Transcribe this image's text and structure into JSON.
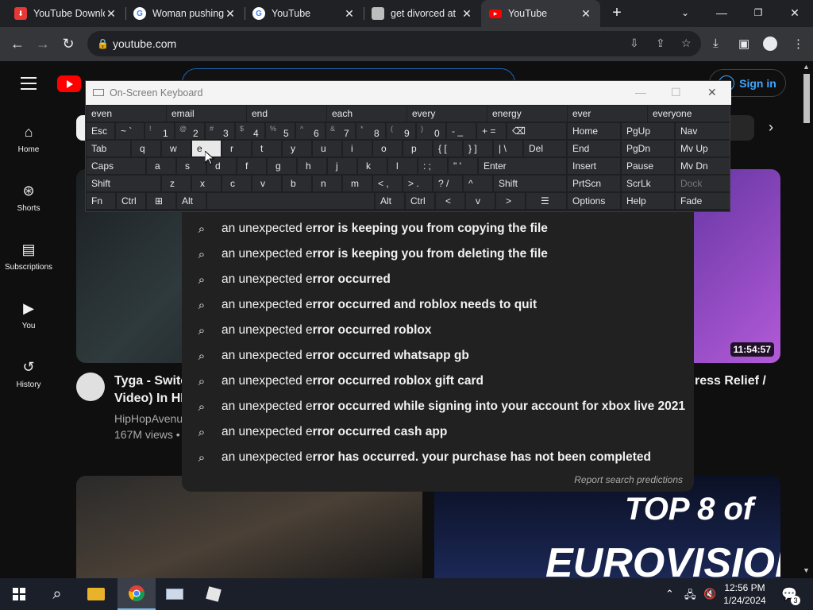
{
  "browser": {
    "tabs": [
      {
        "title": "YouTube Downlo",
        "favicon": "youtube-downloader-icon"
      },
      {
        "title": "Woman pushing",
        "favicon": "google-icon"
      },
      {
        "title": "YouTube",
        "favicon": "google-icon"
      },
      {
        "title": "get divorced at",
        "favicon": "page-icon"
      },
      {
        "title": "YouTube",
        "favicon": "youtube-icon",
        "active": true
      }
    ],
    "url": "youtube.com"
  },
  "youtube": {
    "signin_label": "Sign in",
    "nav": [
      {
        "label": "Home",
        "icon": "home-icon"
      },
      {
        "label": "Shorts",
        "icon": "shorts-icon"
      },
      {
        "label": "Subscriptions",
        "icon": "subscriptions-icon"
      },
      {
        "label": "You",
        "icon": "you-icon"
      },
      {
        "label": "History",
        "icon": "history-icon"
      }
    ],
    "videos": [
      {
        "title_line1": "Tyga - Switc",
        "title_line2": "Video) In HD",
        "channel": "HipHopAvenu",
        "meta": "167M views •"
      },
      {
        "duration": "11:54:57",
        "title_line1": "ress Relief /"
      }
    ],
    "thumb_text": {
      "line1": "TOP 8 of",
      "line2": "EUROVISION"
    }
  },
  "suggestions": {
    "items": [
      {
        "prefix": "an unexpected e",
        "rest": "rror is keeping you from copying the file"
      },
      {
        "prefix": "an unexpected e",
        "rest": "rror is keeping you from deleting the file"
      },
      {
        "prefix": "an unexpected e",
        "rest": "rror occurred"
      },
      {
        "prefix": "an unexpected e",
        "rest": "rror occurred and roblox needs to quit"
      },
      {
        "prefix": "an unexpected e",
        "rest": "rror occurred roblox"
      },
      {
        "prefix": "an unexpected e",
        "rest": "rror occurred whatsapp gb"
      },
      {
        "prefix": "an unexpected e",
        "rest": "rror occurred roblox gift card"
      },
      {
        "prefix": "an unexpected e",
        "rest": "rror occurred while signing into your account for xbox live 2021"
      },
      {
        "prefix": "an unexpected e",
        "rest": "rror occurred cash app"
      },
      {
        "prefix": "an unexpected e",
        "rest": "rror has occurred. your purchase has not been completed"
      }
    ],
    "report_label": "Report search predictions"
  },
  "osk": {
    "title": "On-Screen Keyboard",
    "predictions": [
      "even",
      "email",
      "end",
      "each",
      "every",
      "energy",
      "ever",
      "everyone"
    ],
    "rows": {
      "r1": [
        "Esc",
        "~ `",
        "1",
        "2",
        "3",
        "4",
        "5",
        "6",
        "7",
        "8",
        "9",
        "0",
        "- _",
        "+ =",
        "⌫"
      ],
      "r1_sup": [
        "",
        "",
        "!",
        "@",
        "#",
        "$",
        "%",
        "^",
        "&",
        "*",
        "(",
        ")",
        "",
        "",
        ""
      ],
      "r2": [
        "Tab",
        "q",
        "w",
        "e",
        "r",
        "t",
        "y",
        "u",
        "i",
        "o",
        "p",
        "{ [",
        "} ]",
        "| \\",
        "Del"
      ],
      "r3": [
        "Caps",
        "a",
        "s",
        "d",
        "f",
        "g",
        "h",
        "j",
        "k",
        "l",
        ": ;",
        "\" '",
        "Enter"
      ],
      "r4": [
        "Shift",
        "z",
        "x",
        "c",
        "v",
        "b",
        "n",
        "m",
        "< ,",
        "> .",
        "? /",
        "^",
        "Shift"
      ],
      "r5": [
        "Fn",
        "Ctrl",
        "⊞",
        "Alt",
        "Alt",
        "Ctrl",
        "<",
        "v",
        ">",
        "☰"
      ]
    },
    "nav_keys": [
      [
        "Home",
        "PgUp",
        "Nav"
      ],
      [
        "End",
        "PgDn",
        "Mv Up"
      ],
      [
        "Insert",
        "Pause",
        "Mv Dn"
      ],
      [
        "PrtScn",
        "ScrLk",
        "Dock"
      ],
      [
        "Options",
        "Help",
        "Fade"
      ]
    ],
    "highlighted_key": "e"
  },
  "taskbar": {
    "time": "12:56 PM",
    "date": "1/24/2024",
    "notification_count": "3"
  }
}
